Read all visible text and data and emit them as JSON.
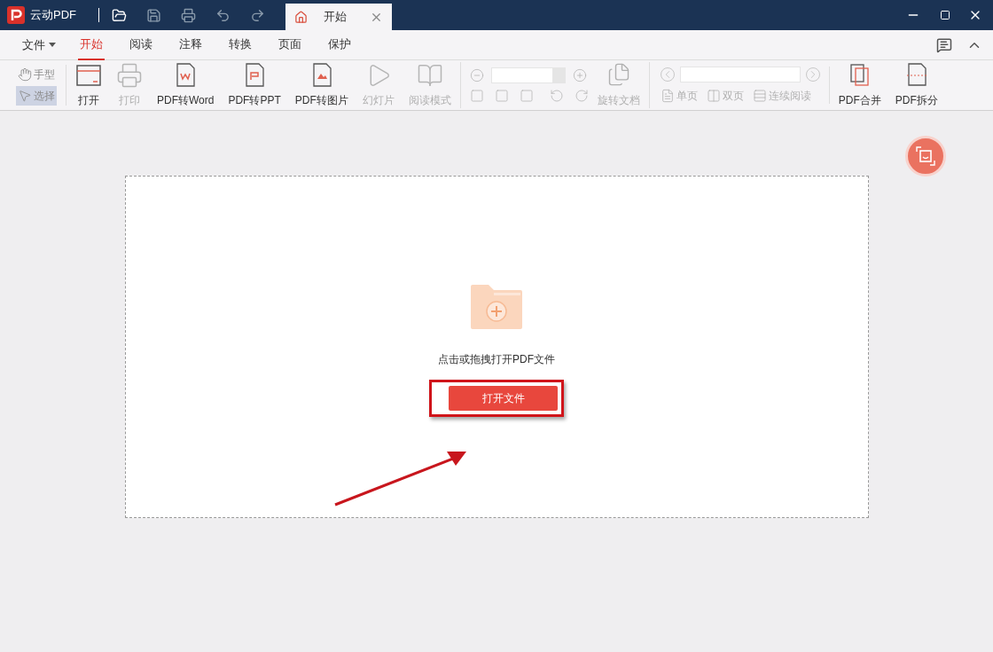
{
  "app": {
    "name": "云动PDF"
  },
  "doc_tab": {
    "title": "开始",
    "selected": true
  },
  "menu": {
    "file": "文件",
    "tabs": [
      {
        "label": "开始",
        "selected": true
      },
      {
        "label": "阅读",
        "selected": false
      },
      {
        "label": "注释",
        "selected": false
      },
      {
        "label": "转换",
        "selected": false
      },
      {
        "label": "页面",
        "selected": false
      },
      {
        "label": "保护",
        "selected": false
      }
    ]
  },
  "tools": [
    {
      "label": "手型",
      "selected": false,
      "disabled": true
    },
    {
      "label": "选择",
      "selected": true,
      "disabled": true
    }
  ],
  "toolbar": [
    {
      "kind": "open",
      "label": "打开",
      "disabled": false
    },
    {
      "kind": "print",
      "label": "打印",
      "disabled": true
    },
    {
      "kind": "word",
      "label": "PDF转Word",
      "disabled": false
    },
    {
      "kind": "ppt",
      "label": "PDF转PPT",
      "disabled": false
    },
    {
      "kind": "image",
      "label": "PDF转图片",
      "disabled": false
    },
    {
      "kind": "slide",
      "label": "幻灯片",
      "disabled": true
    },
    {
      "kind": "read",
      "label": "阅读模式",
      "disabled": true
    }
  ],
  "rotate": {
    "label": "旋转文档",
    "disabled": true
  },
  "views": [
    {
      "kind": "single",
      "label": "单页",
      "disabled": true
    },
    {
      "kind": "double",
      "label": "双页",
      "disabled": true
    },
    {
      "kind": "continuous",
      "label": "连续阅读",
      "disabled": true
    }
  ],
  "tools_right": [
    {
      "kind": "merge",
      "label": "PDF合并"
    },
    {
      "kind": "split",
      "label": "PDF拆分"
    }
  ],
  "dropzone": {
    "hint": "点击或拖拽打开PDF文件",
    "button": "打开文件",
    "highlighted": true
  }
}
